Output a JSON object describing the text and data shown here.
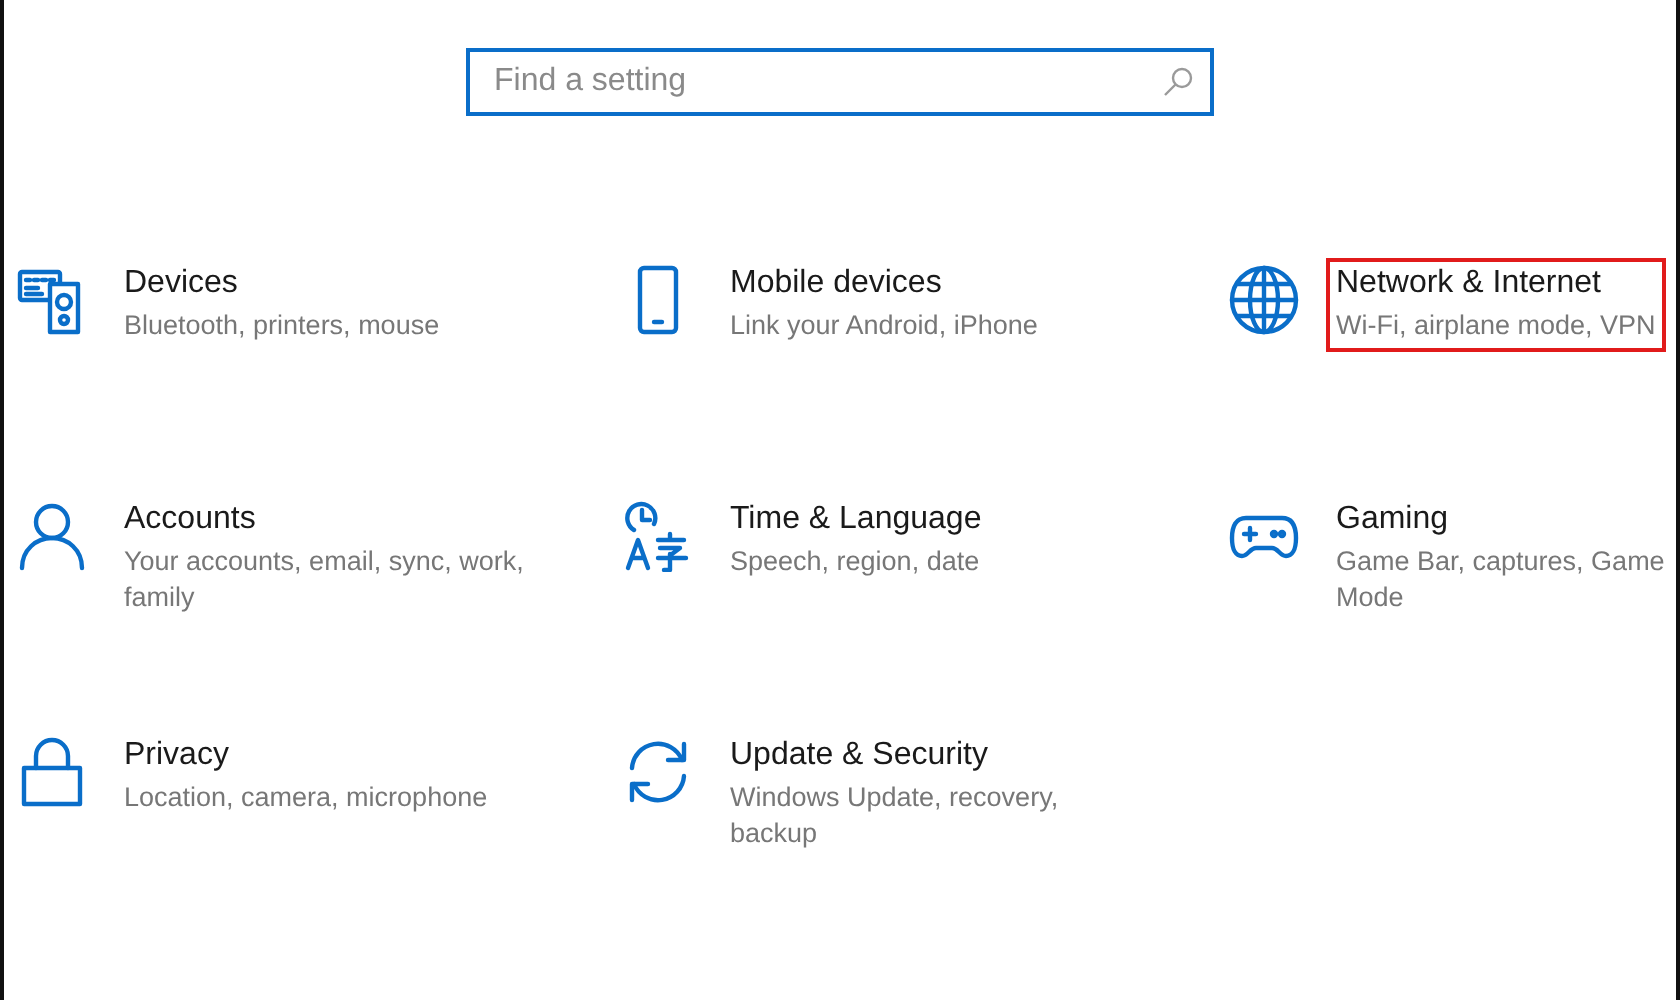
{
  "search": {
    "placeholder": "Find a setting"
  },
  "tiles": [
    {
      "title": "Devices",
      "subtitle": "Bluetooth, printers, mouse",
      "highlighted": false
    },
    {
      "title": "Mobile devices",
      "subtitle": "Link your Android, iPhone",
      "highlighted": false
    },
    {
      "title": "Network & Internet",
      "subtitle": "Wi-Fi, airplane mode, VPN",
      "highlighted": true
    },
    {
      "title": "Accounts",
      "subtitle": "Your accounts, email, sync, work, family",
      "highlighted": false
    },
    {
      "title": "Time & Language",
      "subtitle": "Speech, region, date",
      "highlighted": false
    },
    {
      "title": "Gaming",
      "subtitle": "Game Bar, captures, Game Mode",
      "highlighted": false
    },
    {
      "title": "Privacy",
      "subtitle": "Location, camera, microphone",
      "highlighted": false
    },
    {
      "title": "Update & Security",
      "subtitle": "Windows Update, recovery, backup",
      "highlighted": false
    }
  ]
}
